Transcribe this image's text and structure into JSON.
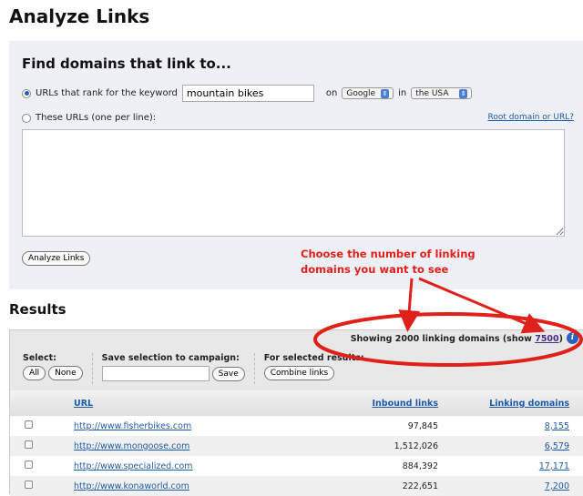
{
  "page_title": "Analyze Links",
  "form": {
    "heading": "Find domains that link to...",
    "option_keyword_label": "URLs that rank for the keyword",
    "keyword_value": "mountain bikes",
    "on_label": "on",
    "engine": "Google",
    "in_label": "in",
    "country": "the USA",
    "option_urls_label": "These URLs (one per line):",
    "root_link": "Root domain or URL?",
    "urls_value": "",
    "analyze_button": "Analyze Links"
  },
  "annotation": {
    "line1": "Choose the number of linking",
    "line2": "domains you want to see"
  },
  "results": {
    "heading": "Results",
    "showing_text": "Showing 2000 linking domains (show ",
    "show_link": "7500",
    "showing_close": ")",
    "info_icon": "i",
    "select_label": "Select:",
    "all_button": "All",
    "none_button": "None",
    "save_label": "Save selection to campaign:",
    "save_button": "Save",
    "for_selected_label": "For selected results:",
    "combine_button": "Combine links",
    "columns": [
      "URL",
      "Inbound links",
      "Linking domains"
    ],
    "rows": [
      {
        "url": "http://www.fisherbikes.com",
        "inbound": "97,845",
        "domains": "8,155"
      },
      {
        "url": "http://www.mongoose.com",
        "inbound": "1,512,026",
        "domains": "6,579"
      },
      {
        "url": "http://www.specialized.com",
        "inbound": "884,392",
        "domains": "17,171"
      },
      {
        "url": "http://www.konaworld.com",
        "inbound": "222,651",
        "domains": "7,200"
      }
    ]
  }
}
